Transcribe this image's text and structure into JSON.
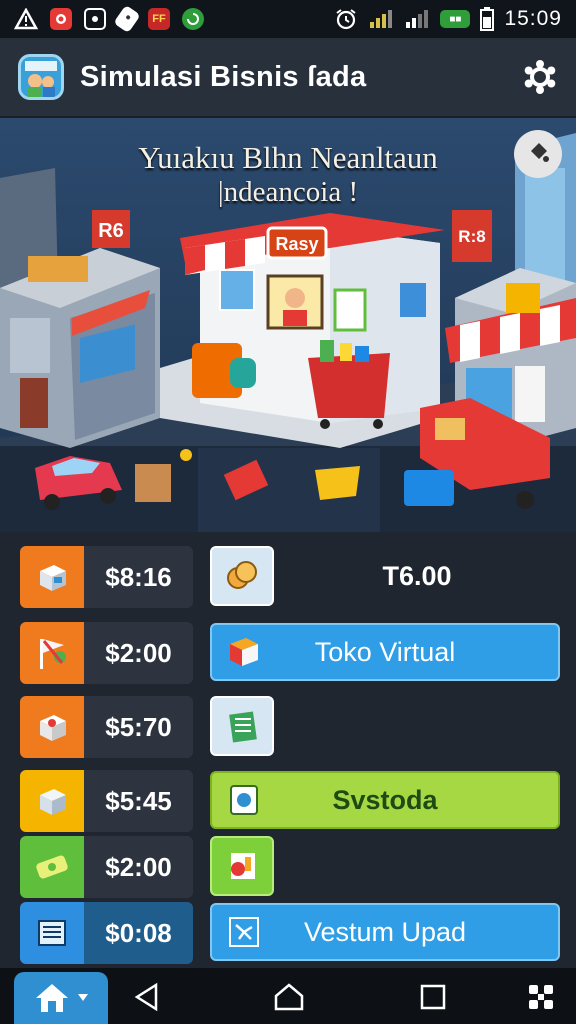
{
  "status_bar": {
    "time": "15:09",
    "left_icons": [
      "alert-icon",
      "mail-icon",
      "camera-icon",
      "shopping-tag-icon",
      "app-ff-icon",
      "sync-icon"
    ],
    "right_icons": [
      "alarm-icon",
      "signal-icon",
      "signal-icon",
      "battery-icon"
    ]
  },
  "app": {
    "title": "Simulasi Bisnis ſada"
  },
  "hero": {
    "title_line1": "Yuıakıu Blhn Neanltaun",
    "title_line2": "|ndeancoia !",
    "store_sign": "Rasy",
    "left_sign": "R6",
    "right_sign": "R:8"
  },
  "left_items": [
    {
      "price": "$8:16",
      "icon": "box-icon",
      "color": "#f07a1e"
    },
    {
      "price": "$2:00",
      "icon": "flag-icon",
      "color": "#f07a1e"
    },
    {
      "price": "$5:70",
      "icon": "package-icon",
      "color": "#f07a1e"
    },
    {
      "price": "$5:45",
      "icon": "crate-icon",
      "color": "#f5b400"
    },
    {
      "price": "$2:00",
      "icon": "cash-icon",
      "color": "#5fbe3c"
    },
    {
      "price": "$0:08",
      "icon": "document-icon",
      "color": "#2e8fe0"
    }
  ],
  "right_items": [
    {
      "label": "T6.00",
      "icon": "coins-icon",
      "style": "plain"
    },
    {
      "label": "Toko Virtual",
      "icon": "shop-box-icon",
      "style": "blue"
    },
    {
      "label": "",
      "icon": "ledger-icon",
      "style": "plain"
    },
    {
      "label": "Svstoda",
      "icon": "stats-icon",
      "style": "green"
    },
    {
      "label": "",
      "icon": "chart-card-icon",
      "style": "plain"
    },
    {
      "label": "Vestum Upad",
      "icon": "network-icon",
      "style": "blue"
    }
  ],
  "colors": {
    "blue_bar": "#2f9ee6",
    "green_bar": "#a5d843",
    "panel": "#1f2630",
    "tile_dark": "#2d3440"
  },
  "nav": {
    "home_icon": "home-icon",
    "back_icon": "back-icon",
    "home_button_icon": "home-outline-icon",
    "recents_icon": "recents-icon",
    "apps_icon": "apps-grid-icon"
  }
}
